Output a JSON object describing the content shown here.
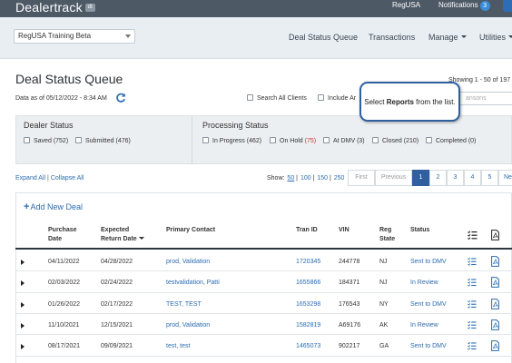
{
  "topbar": {
    "logo": "Dealertrack",
    "logo_badge": "dt",
    "reg_link": "RegUSA",
    "notifications_label": "Notifications",
    "notifications_count": "3"
  },
  "navbar": {
    "client_select_value": "RegUSA Training Beta",
    "links": {
      "deal_status_queue": "Deal Status Queue",
      "transactions": "Transactions",
      "manage": "Manage",
      "utilities": "Utilities"
    }
  },
  "page": {
    "title": "Deal Status Queue",
    "data_as_of": "Data as of 05/12/2022 - 8:34 AM",
    "showing": "Showing 1 - 50 of 197",
    "search_all_clients": "Search All Clients",
    "include_archived": "Include Ar",
    "search_placeholder": "ansons"
  },
  "tooltip": {
    "prefix": "Select ",
    "bold": "Reports",
    "suffix": " from the list."
  },
  "dealer_status": {
    "heading": "Dealer Status",
    "items": [
      {
        "label": "Saved",
        "count": "(752)"
      },
      {
        "label": "Submitted",
        "count": "(476)"
      }
    ]
  },
  "processing_status": {
    "heading": "Processing Status",
    "items": [
      {
        "label": "In Progress",
        "count": "(462)"
      },
      {
        "label": "On Hold",
        "count": "(75)"
      },
      {
        "label": "At DMV",
        "count": "(3)"
      },
      {
        "label": "Closed",
        "count": "(210)"
      },
      {
        "label": "Completed",
        "count": "(0)"
      }
    ]
  },
  "toolbar": {
    "expand_all": "Expand All",
    "separator": "|",
    "collapse_all": "Collapse All",
    "show_label": "Show:",
    "show_options": [
      "50",
      "100",
      "150",
      "250"
    ],
    "show_selected": "50"
  },
  "pagination": {
    "first": "First",
    "previous": "Previous",
    "pages": [
      "1",
      "2",
      "3",
      "4",
      "5"
    ],
    "current": "1",
    "next": "Ne"
  },
  "table": {
    "add_new_deal": "Add New Deal",
    "headers": {
      "purchase_date_1": "Purchase",
      "purchase_date_2": "Date",
      "expected_return_1": "Expected",
      "expected_return_2": "Return Date",
      "primary_contact": "Primary Contact",
      "tran_id": "Tran ID",
      "vin": "VIN",
      "reg_state_1": "Reg",
      "reg_state_2": "State",
      "status": "Status"
    },
    "rows": [
      {
        "purchase": "04/11/2022",
        "expected": "04/28/2022",
        "contact": "prod, Validation",
        "tran_id": "1720345",
        "vin": "244778",
        "state": "NJ",
        "status": "Sent to DMV"
      },
      {
        "purchase": "02/03/2022",
        "expected": "02/24/2022",
        "contact": "testvalidation, Patti",
        "tran_id": "1655866",
        "vin": "184371",
        "state": "NJ",
        "status": "In Review"
      },
      {
        "purchase": "01/26/2022",
        "expected": "02/17/2022",
        "contact": "TEST, TEST",
        "tran_id": "1653298",
        "vin": "176543",
        "state": "NY",
        "status": "Sent to DMV"
      },
      {
        "purchase": "11/10/2021",
        "expected": "12/15/2021",
        "contact": "prod, Validation",
        "tran_id": "1582819",
        "vin": "A69176",
        "state": "AK",
        "status": "In Review"
      },
      {
        "purchase": "08/17/2021",
        "expected": "09/09/2021",
        "contact": "test, test",
        "tran_id": "1465073",
        "vin": "902217",
        "state": "GA",
        "status": "Sent to DMV"
      }
    ]
  },
  "colors": {
    "topbar": "#4e5966",
    "navbar": "#e9eef3",
    "link": "#2b6cb0",
    "active_page": "#2f5f9e",
    "on_hold_count": "#c0392b"
  }
}
